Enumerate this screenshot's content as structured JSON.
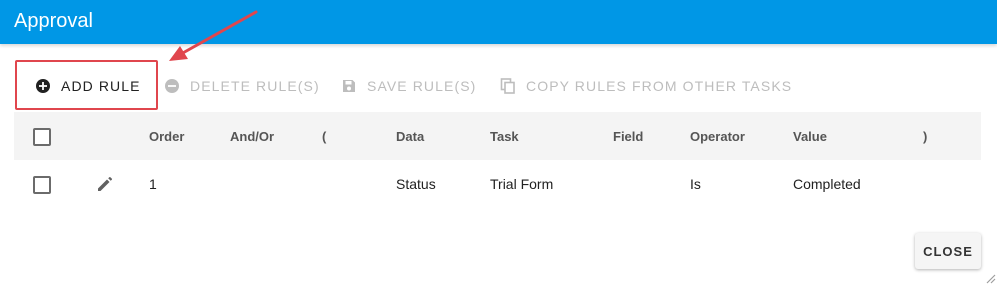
{
  "header": {
    "title": "Approval"
  },
  "toolbar": {
    "add_rule": {
      "label": "ADD RULE",
      "icon": "plus-circle-icon"
    },
    "delete_rules": {
      "label": "DELETE RULE(S)",
      "icon": "minus-circle-icon"
    },
    "save_rules": {
      "label": "SAVE RULE(S)",
      "icon": "save-icon"
    },
    "copy_rules": {
      "label": "COPY RULES FROM OTHER TASKS",
      "icon": "copy-icon"
    }
  },
  "table": {
    "columns": {
      "order": "Order",
      "and_or": "And/Or",
      "open_paren": "(",
      "data": "Data",
      "task": "Task",
      "field": "Field",
      "operator": "Operator",
      "value": "Value",
      "close_paren": ")"
    },
    "rows": [
      {
        "order": "1",
        "and_or": "",
        "open_paren": "",
        "data": "Status",
        "task": "Trial Form",
        "field": "",
        "operator": "Is",
        "value": "Completed",
        "close_paren": ""
      }
    ]
  },
  "footer": {
    "close_label": "CLOSE"
  },
  "colors": {
    "header": "#0097e6",
    "highlight": "#e0464d",
    "disabled": "#bdbdbd"
  }
}
